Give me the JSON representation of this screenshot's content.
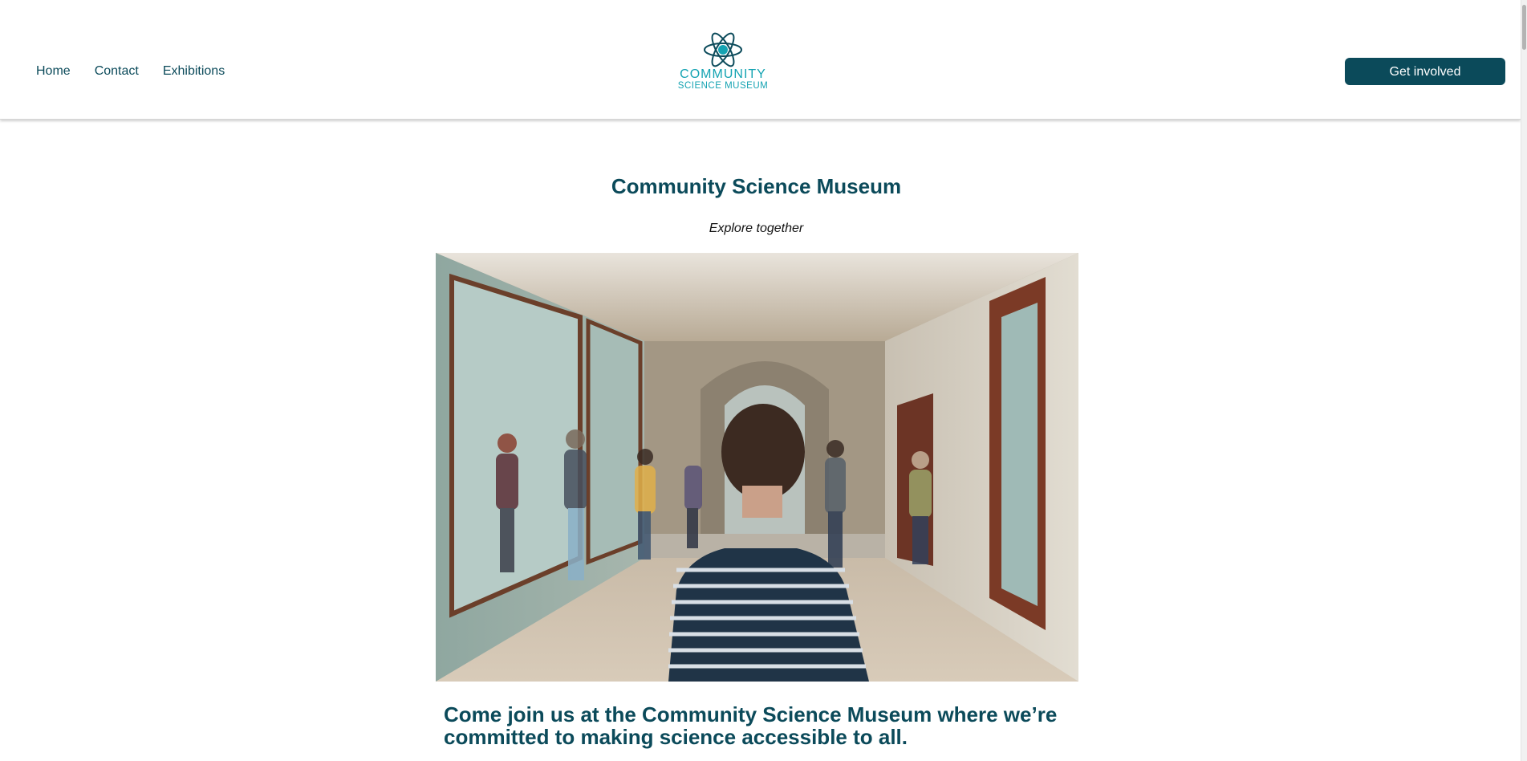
{
  "nav": {
    "items": [
      "Home",
      "Contact",
      "Exhibitions"
    ]
  },
  "logo": {
    "line1": "COMMUNITY",
    "line2": "SCIENCE MUSEUM",
    "icon": "atom-icon"
  },
  "header": {
    "cta_label": "Get involved"
  },
  "main": {
    "title": "Community Science Museum",
    "tagline": "Explore together",
    "hero_image": "museum-hall-photo",
    "intro": "Come join us at the Community Science Museum where we’re committed to making science accessible to all."
  },
  "colors": {
    "brand_dark": "#0b4a5a",
    "brand_teal": "#14a3b2"
  }
}
